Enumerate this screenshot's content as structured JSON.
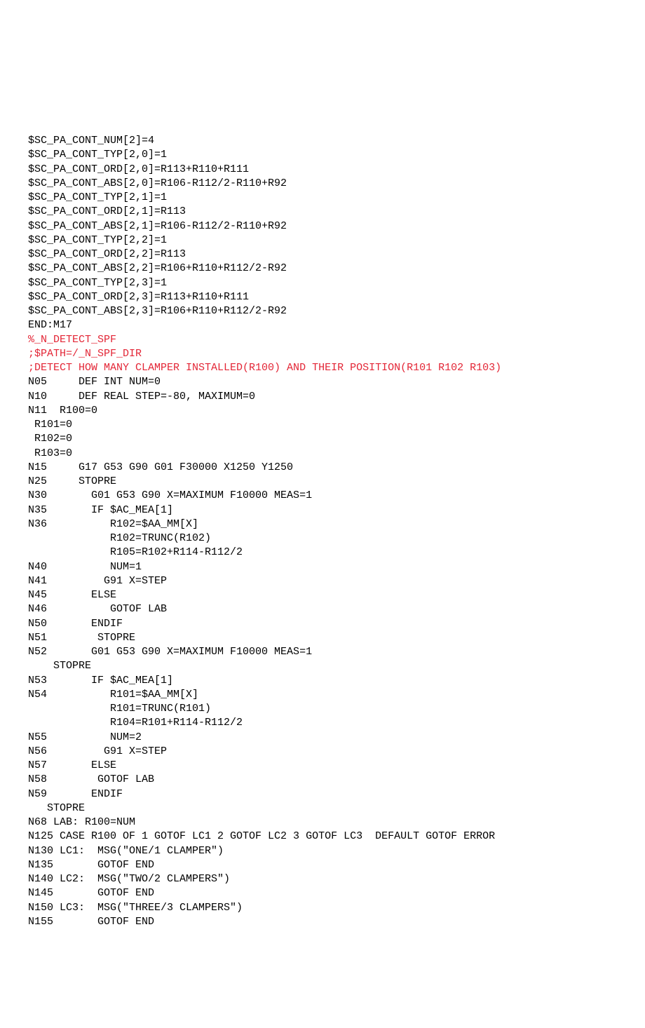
{
  "lines": [
    {
      "text": "$SC_PA_CONT_NUM[2]=4",
      "cls": ""
    },
    {
      "text": "$SC_PA_CONT_TYP[2,0]=1",
      "cls": ""
    },
    {
      "text": "$SC_PA_CONT_ORD[2,0]=R113+R110+R111",
      "cls": ""
    },
    {
      "text": "$SC_PA_CONT_ABS[2,0]=R106-R112/2-R110+R92",
      "cls": ""
    },
    {
      "text": "$SC_PA_CONT_TYP[2,1]=1",
      "cls": ""
    },
    {
      "text": "$SC_PA_CONT_ORD[2,1]=R113",
      "cls": ""
    },
    {
      "text": "$SC_PA_CONT_ABS[2,1]=R106-R112/2-R110+R92",
      "cls": ""
    },
    {
      "text": "$SC_PA_CONT_TYP[2,2]=1",
      "cls": ""
    },
    {
      "text": "$SC_PA_CONT_ORD[2,2]=R113",
      "cls": ""
    },
    {
      "text": "$SC_PA_CONT_ABS[2,2]=R106+R110+R112/2-R92",
      "cls": ""
    },
    {
      "text": "$SC_PA_CONT_TYP[2,3]=1",
      "cls": ""
    },
    {
      "text": "$SC_PA_CONT_ORD[2,3]=R113+R110+R111",
      "cls": ""
    },
    {
      "text": "$SC_PA_CONT_ABS[2,3]=R106+R110+R112/2-R92",
      "cls": ""
    },
    {
      "text": "END:M17",
      "cls": ""
    },
    {
      "text": "",
      "cls": ""
    },
    {
      "text": "",
      "cls": ""
    },
    {
      "text": "",
      "cls": ""
    },
    {
      "text": "",
      "cls": ""
    },
    {
      "text": "%_N_DETECT_SPF",
      "cls": "red"
    },
    {
      "text": ";$PATH=/_N_SPF_DIR",
      "cls": "red"
    },
    {
      "text": ";DETECT HOW MANY CLAMPER INSTALLED(R100) AND THEIR POSITION(R101 R102 R103)",
      "cls": "red"
    },
    {
      "text": "N05     DEF INT NUM=0",
      "cls": ""
    },
    {
      "text": "N10     DEF REAL STEP=-80, MAXIMUM=0",
      "cls": ""
    },
    {
      "text": "N11  R100=0",
      "cls": ""
    },
    {
      "text": " R101=0",
      "cls": ""
    },
    {
      "text": " R102=0",
      "cls": ""
    },
    {
      "text": " R103=0",
      "cls": ""
    },
    {
      "text": "N15     G17 G53 G90 G01 F30000 X1250 Y1250",
      "cls": ""
    },
    {
      "text": "",
      "cls": ""
    },
    {
      "text": "N25     STOPRE",
      "cls": ""
    },
    {
      "text": "N30       G01 G53 G90 X=MAXIMUM F10000 MEAS=1",
      "cls": ""
    },
    {
      "text": "N35       IF $AC_MEA[1]",
      "cls": ""
    },
    {
      "text": "N36          R102=$AA_MM[X]",
      "cls": ""
    },
    {
      "text": "             R102=TRUNC(R102)",
      "cls": ""
    },
    {
      "text": "             R105=R102+R114-R112/2",
      "cls": ""
    },
    {
      "text": "N40          NUM=1",
      "cls": ""
    },
    {
      "text": "N41         G91 X=STEP",
      "cls": ""
    },
    {
      "text": "N45       ELSE",
      "cls": ""
    },
    {
      "text": "N46          GOTOF LAB",
      "cls": ""
    },
    {
      "text": "N50       ENDIF",
      "cls": ""
    },
    {
      "text": "N51        STOPRE",
      "cls": ""
    },
    {
      "text": "N52       G01 G53 G90 X=MAXIMUM F10000 MEAS=1",
      "cls": ""
    },
    {
      "text": "    STOPRE",
      "cls": ""
    },
    {
      "text": "N53       IF $AC_MEA[1]",
      "cls": ""
    },
    {
      "text": "N54          R101=$AA_MM[X]",
      "cls": ""
    },
    {
      "text": "             R101=TRUNC(R101)",
      "cls": ""
    },
    {
      "text": "             R104=R101+R114-R112/2",
      "cls": ""
    },
    {
      "text": "N55          NUM=2",
      "cls": ""
    },
    {
      "text": "N56         G91 X=STEP",
      "cls": ""
    },
    {
      "text": "N57       ELSE",
      "cls": ""
    },
    {
      "text": "N58        GOTOF LAB",
      "cls": ""
    },
    {
      "text": "N59       ENDIF",
      "cls": ""
    },
    {
      "text": "   STOPRE",
      "cls": ""
    },
    {
      "text": "N68 LAB: R100=NUM",
      "cls": ""
    },
    {
      "text": "N125 CASE R100 OF 1 GOTOF LC1 2 GOTOF LC2 3 GOTOF LC3  DEFAULT GOTOF ERROR",
      "cls": ""
    },
    {
      "text": "N130 LC1:  MSG(\"ONE/1 CLAMPER\")",
      "cls": ""
    },
    {
      "text": "N135       GOTOF END",
      "cls": ""
    },
    {
      "text": "N140 LC2:  MSG(\"TWO/2 CLAMPERS\")",
      "cls": ""
    },
    {
      "text": "N145       GOTOF END",
      "cls": ""
    },
    {
      "text": "N150 LC3:  MSG(\"THREE/3 CLAMPERS\")",
      "cls": ""
    },
    {
      "text": "N155       GOTOF END",
      "cls": ""
    }
  ]
}
